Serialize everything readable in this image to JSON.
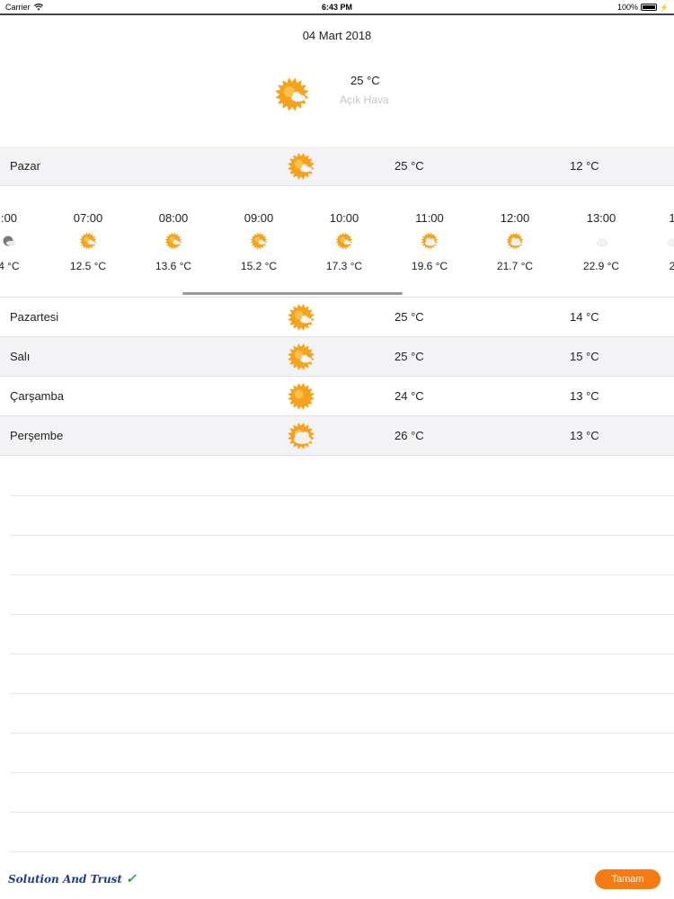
{
  "status_bar": {
    "carrier": "Carrier",
    "time": "6:43 PM",
    "battery": "100%"
  },
  "header": {
    "date": "04 Mart 2018",
    "current_temp": "25 °C",
    "current_desc": "Açık Hava",
    "current_icon": "sun-partly-cloudy-icon"
  },
  "today": {
    "day": "Pazar",
    "high": "25 °C",
    "low": "12 °C",
    "icon": "sun-partly-cloudy-icon"
  },
  "hourly": [
    {
      "time": ":00",
      "temp": "4 °C",
      "icon": "moon-cloud-icon"
    },
    {
      "time": "07:00",
      "temp": "12.5 °C",
      "icon": "sun-partly-cloudy-icon"
    },
    {
      "time": "08:00",
      "temp": "13.6 °C",
      "icon": "sun-partly-cloudy-icon"
    },
    {
      "time": "09:00",
      "temp": "15.2 °C",
      "icon": "sun-partly-cloudy-icon"
    },
    {
      "time": "10:00",
      "temp": "17.3 °C",
      "icon": "sun-partly-cloudy-icon"
    },
    {
      "time": "11:00",
      "temp": "19.6 °C",
      "icon": "sun-cloudy-icon"
    },
    {
      "time": "12:00",
      "temp": "21.7 °C",
      "icon": "sun-cloudy-icon"
    },
    {
      "time": "13:00",
      "temp": "22.9 °C",
      "icon": "cloud-icon"
    },
    {
      "time": "1",
      "temp": "2",
      "icon": "cloud-icon"
    }
  ],
  "forecast": [
    {
      "day": "Pazartesi",
      "high": "25 °C",
      "low": "14 °C",
      "icon": "sun-partly-cloudy-icon"
    },
    {
      "day": "Salı",
      "high": "25 °C",
      "low": "15 °C",
      "icon": "sun-partly-cloudy-icon"
    },
    {
      "day": "Çarşamba",
      "high": "24 °C",
      "low": "13 °C",
      "icon": "sun-icon"
    },
    {
      "day": "Perşembe",
      "high": "26 °C",
      "low": "13 °C",
      "icon": "sun-cloudy-icon"
    }
  ],
  "footer": {
    "brand": "Solution And Trust",
    "ok_button": "Tamam"
  },
  "colors": {
    "accent": "#f57b12",
    "sun": "#f5a21c",
    "desc": "#c6c6c6",
    "row_shade": "#f3f3f5"
  }
}
